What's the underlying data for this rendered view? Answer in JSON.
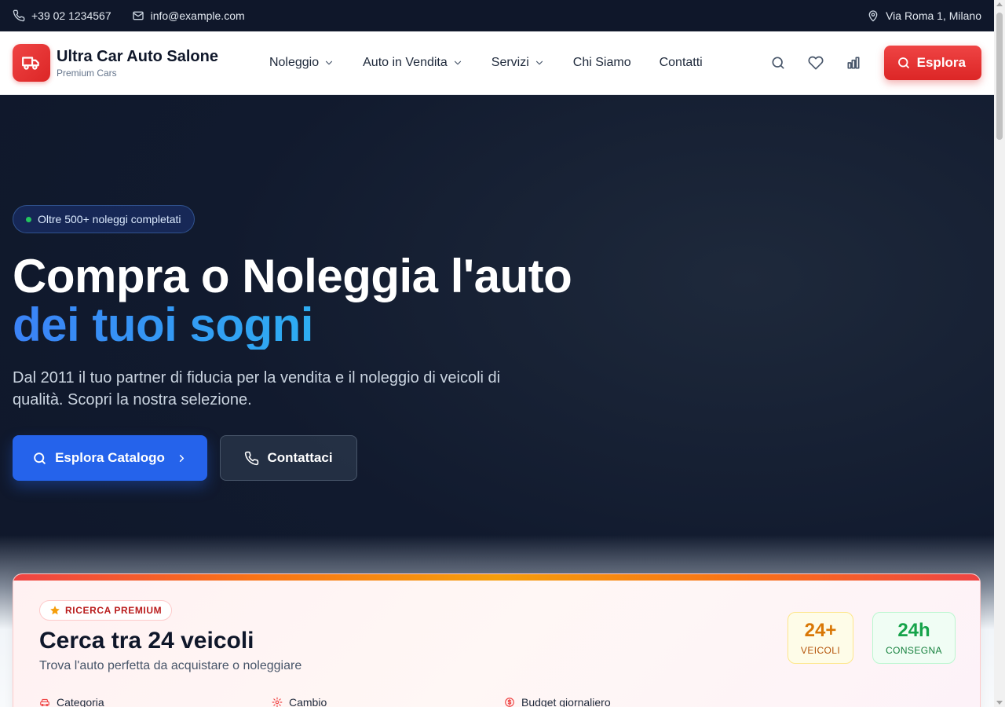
{
  "topbar": {
    "phone": "+39 02 1234567",
    "email": "info@example.com",
    "address": "Via Roma 1, Milano"
  },
  "brand": {
    "name": "Ultra Car Auto Salone",
    "tagline": "Premium Cars",
    "icon": "truck-icon",
    "accent": "#dc2626"
  },
  "nav": {
    "items": [
      {
        "label": "Noleggio",
        "dropdown": true
      },
      {
        "label": "Auto in Vendita",
        "dropdown": true
      },
      {
        "label": "Servizi",
        "dropdown": true
      },
      {
        "label": "Chi Siamo",
        "dropdown": false
      },
      {
        "label": "Contatti",
        "dropdown": false
      }
    ],
    "icons": [
      "search-icon",
      "heart-icon",
      "bar-chart-icon"
    ],
    "cta_label": "Esplora"
  },
  "hero": {
    "badge": "Oltre 500+ noleggi completati",
    "title_line1": "Compra o Noleggia l'auto",
    "title_line2": "dei tuoi sogni",
    "description": "Dal 2011 il tuo partner di fiducia per la vendita e il noleggio di veicoli di qualità. Scopri la nostra selezione.",
    "primary_button": "Esplora Catalogo",
    "secondary_button": "Contattaci",
    "primary_color": "#2563eb"
  },
  "search": {
    "badge": "RICERCA PREMIUM",
    "title": "Cerca tra 24 veicoli",
    "subtitle": "Trova l'auto perfetta da acquistare o noleggiare",
    "stats": [
      {
        "value": "24+",
        "label": "VEICOLI"
      },
      {
        "value": "24h",
        "label": "CONSEGNA"
      }
    ],
    "fields": [
      {
        "label": "Categoria",
        "icon": "car-icon"
      },
      {
        "label": "Cambio",
        "icon": "gear-icon"
      },
      {
        "label": "Budget giornaliero",
        "icon": "dollar-icon"
      }
    ]
  }
}
